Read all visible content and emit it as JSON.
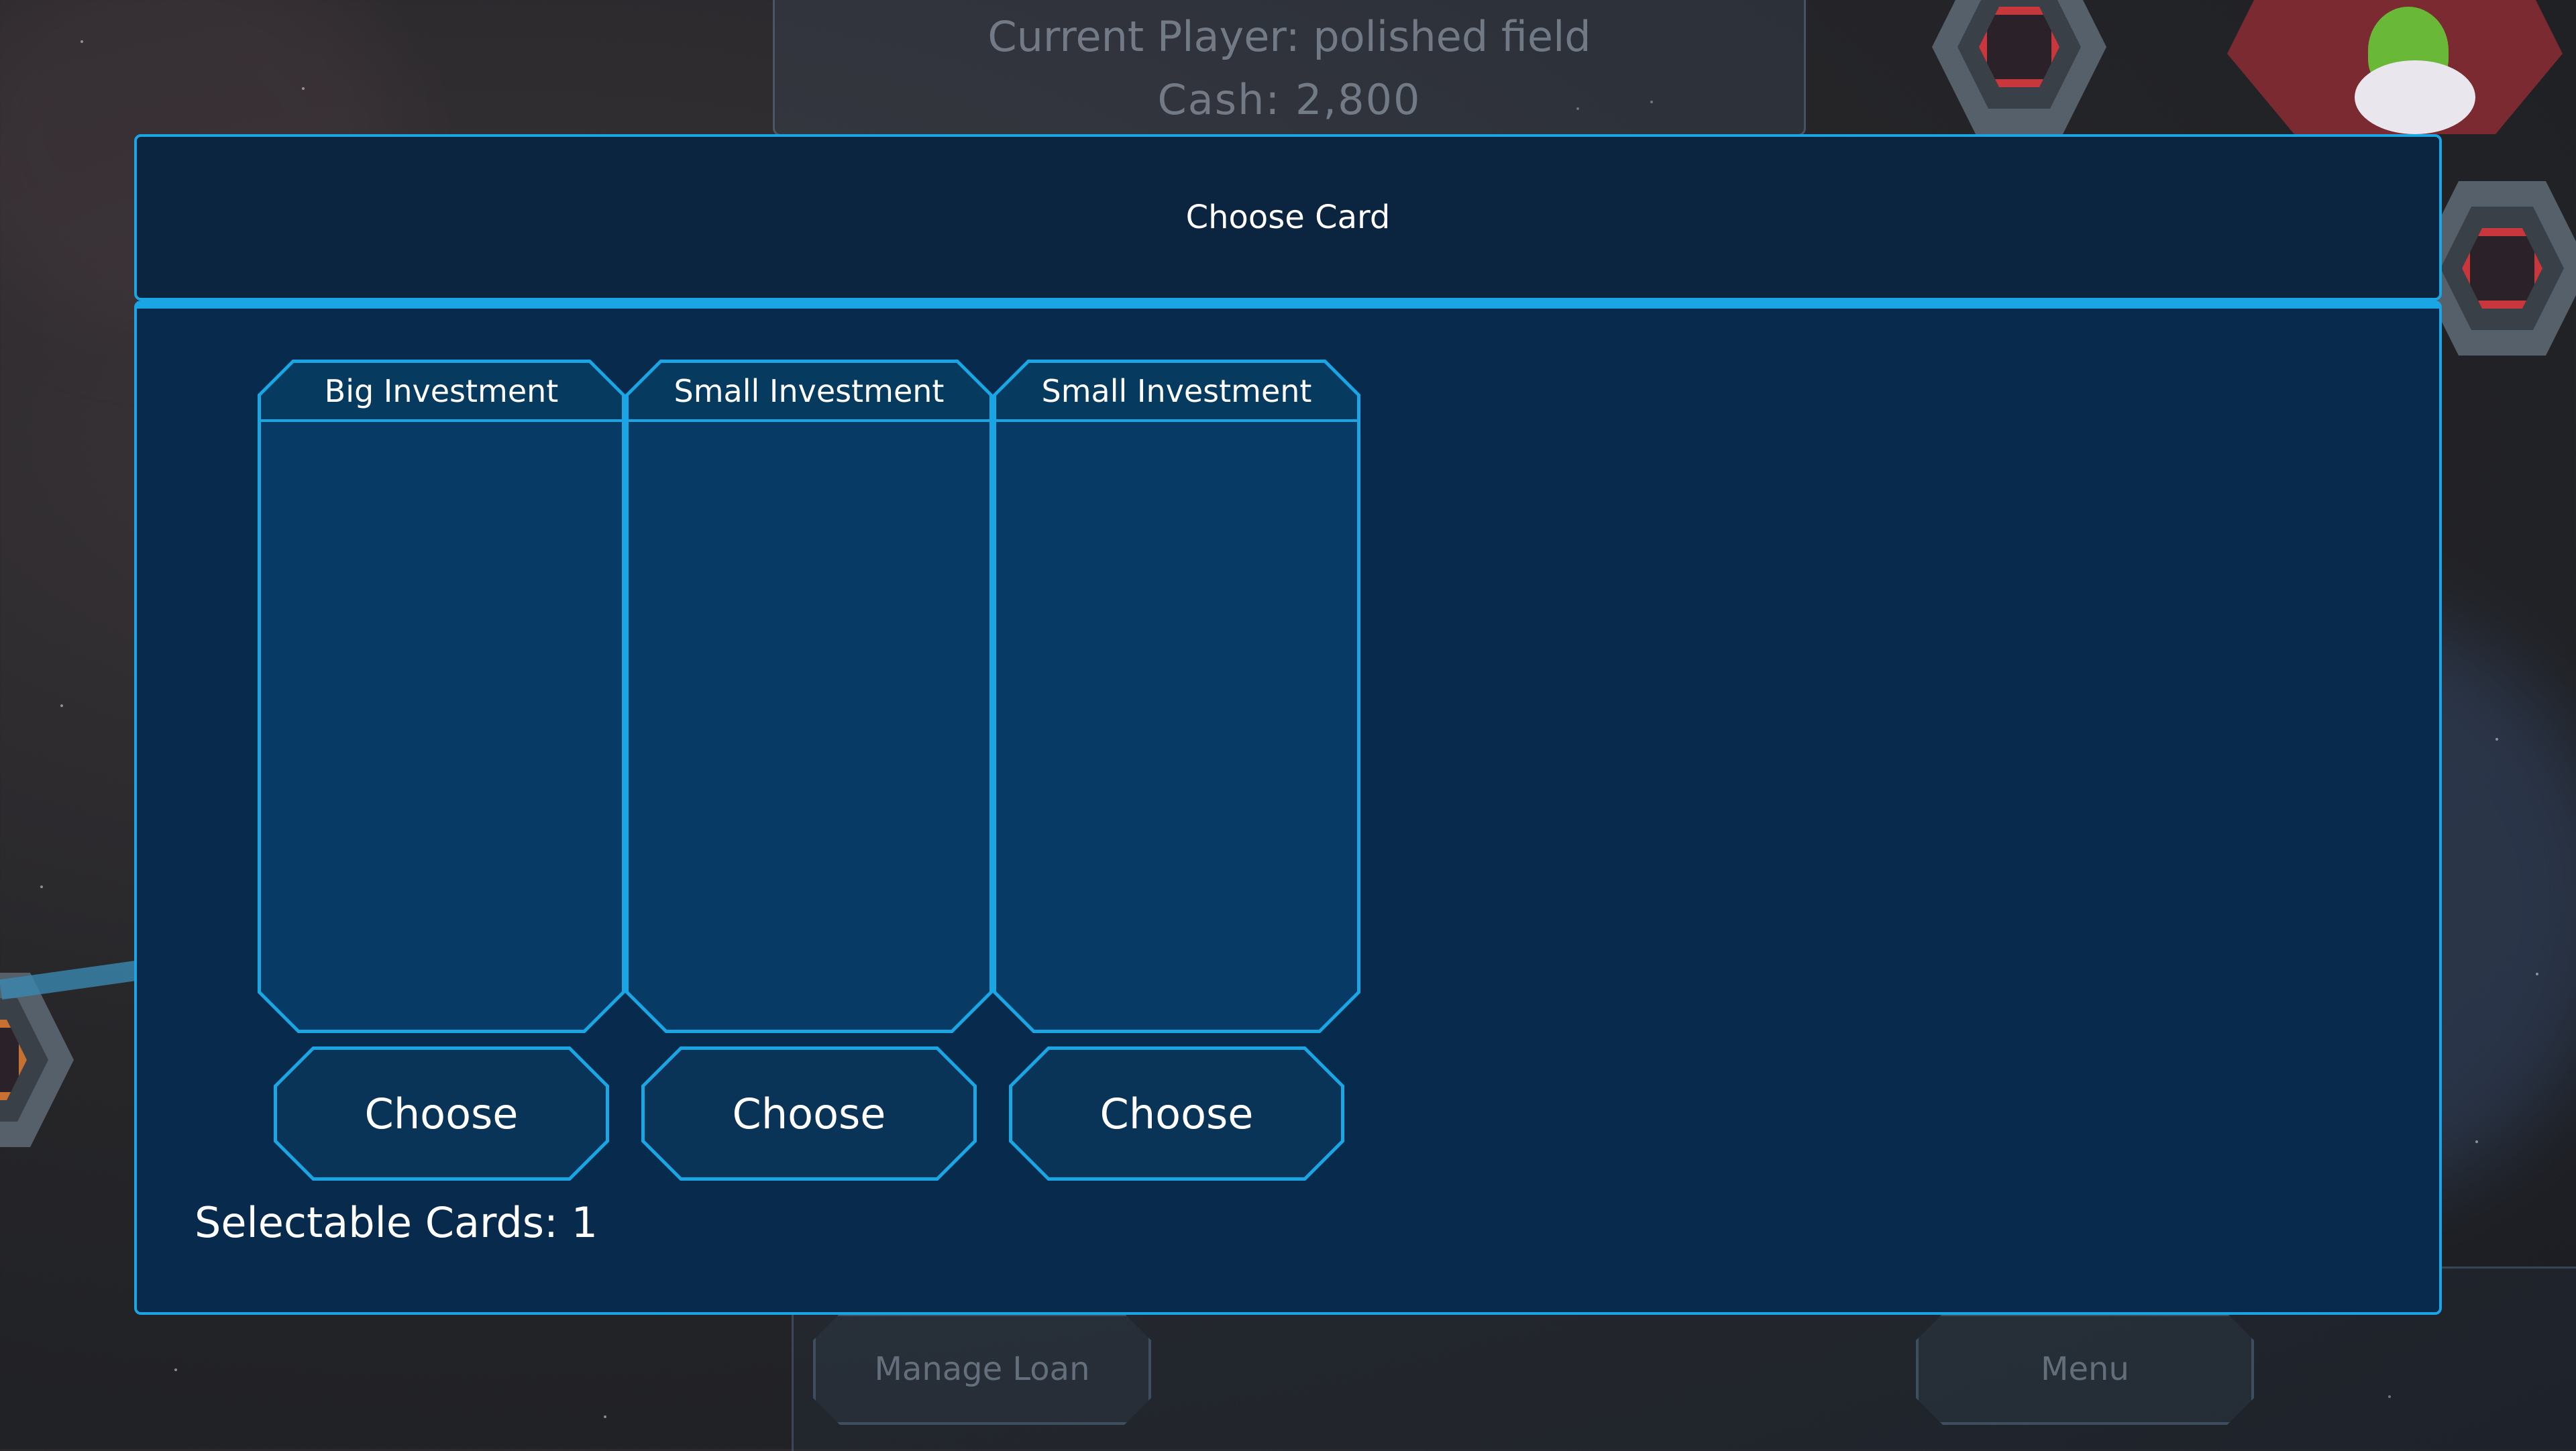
{
  "hud": {
    "current_player": "Current Player: polished field",
    "cash": "Cash: 2,800",
    "manage_loan_label": "Manage Loan",
    "menu_label": "Menu"
  },
  "modal": {
    "title": "Choose Card",
    "cards": [
      {
        "title": "Big Investment",
        "button_label": "Choose"
      },
      {
        "title": "Small Investment",
        "button_label": "Choose"
      },
      {
        "title": "Small Investment",
        "button_label": "Choose"
      }
    ],
    "selectable_text": "Selectable Cards: 1"
  },
  "colors": {
    "accent": "#1aa6e4",
    "panel_header": "#0b2540",
    "panel_body": "#072a4d",
    "card_fill": "#073a64"
  },
  "icons": [
    "hex-tile-icon",
    "hex-tile-icon",
    "frog-character-icon"
  ]
}
